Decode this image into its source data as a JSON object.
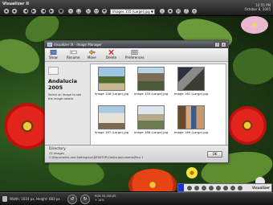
{
  "app": {
    "title": "Visualizer II",
    "file_selected": "Images 155 (Large).jpg",
    "clock_time": "10:55 PM",
    "clock_date": "October 8, 2005"
  },
  "dialog": {
    "title": "Visualizer IX - Image Manager",
    "toolbar": [
      {
        "label": "Show",
        "icon": "show-icon"
      },
      {
        "label": "Rename",
        "icon": "rename-icon"
      },
      {
        "label": "Move",
        "icon": "move-icon"
      },
      {
        "label": "Delete",
        "icon": "delete-icon"
      },
      {
        "label": "Preferences",
        "icon": "preferences-icon"
      }
    ],
    "album_title": "Andalucia 2005",
    "hint": "Select an image to see the image details",
    "thumbnails": [
      {
        "caption": "Image 146 (Large).jpg"
      },
      {
        "caption": "Image 155 (Large).jpg"
      },
      {
        "caption": "Image 161 (Large).jpg"
      },
      {
        "caption": "Image 167 (Large).jpg"
      },
      {
        "caption": "Image 168 (Large).jpg"
      },
      {
        "caption": "Image 169 (Large).jpg"
      }
    ],
    "status_title": "Directory",
    "status_count": "23 Images",
    "status_path": "C:\\Documents and Settings\\vz\\DESKTOP\\Cielito.documents\\Pics 1",
    "ok_label": "OK"
  },
  "bottom": {
    "info": "Width: 1024 px, Height: 683 px",
    "zoom_line1": "RGB 55,165,85",
    "zoom_line2": "+  14%"
  },
  "strip": {
    "brand": "Visualizer"
  },
  "colors": {
    "accent_blue": "#1d2fd3",
    "flower_red": "#d8201a"
  }
}
